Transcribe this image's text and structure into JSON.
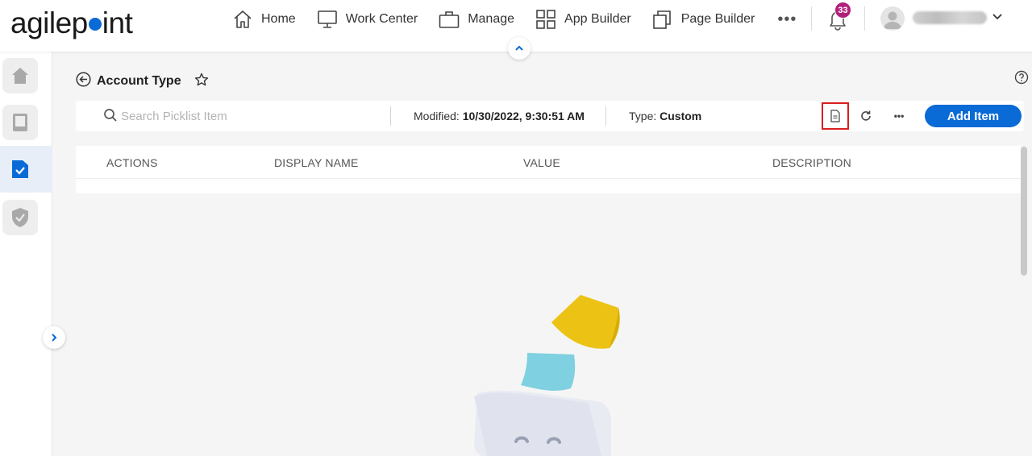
{
  "brand": {
    "logo_text_start": "agilep",
    "logo_text_end": "int"
  },
  "nav": {
    "items": [
      {
        "label": "Home",
        "icon": "home-icon"
      },
      {
        "label": "Work Center",
        "icon": "monitor-icon"
      },
      {
        "label": "Manage",
        "icon": "briefcase-icon"
      },
      {
        "label": "App Builder",
        "icon": "grid-icon"
      },
      {
        "label": "Page Builder",
        "icon": "pages-icon"
      }
    ],
    "more": "•••",
    "notification_count": "33"
  },
  "page": {
    "title": "Account Type",
    "search": {
      "placeholder": "Search Picklist Item",
      "value": ""
    },
    "modified_label": "Modified:",
    "modified_value": "10/30/2022, 9:30:51 AM",
    "type_label": "Type:",
    "type_value": "Custom",
    "more_label": "•••",
    "add_item_label": "Add Item"
  },
  "table": {
    "columns": [
      "ACTIONS",
      "DISPLAY NAME",
      "VALUE",
      "DESCRIPTION"
    ],
    "rows": []
  },
  "colors": {
    "accent": "#0a6ad6",
    "badge": "#b0207a",
    "highlight": "#d81e1e",
    "sticky_yellow": "#ecc315",
    "sticky_blue": "#7fd0e0"
  }
}
